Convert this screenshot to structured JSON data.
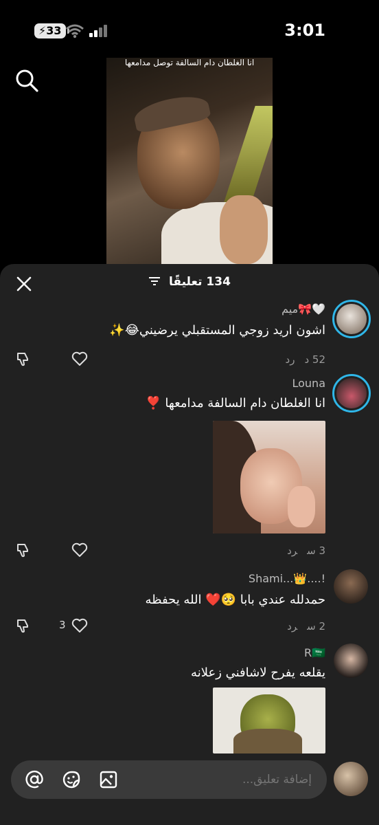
{
  "status_bar": {
    "battery": "33",
    "time": "3:01"
  },
  "video": {
    "overlay_text": "انا الغلطان دام السالفة توصل مدامعها"
  },
  "sheet": {
    "title": "134 تعليقًا"
  },
  "comments": [
    {
      "username": "ميم🎀🤍",
      "text": "اشون اريد زوجي المستقبلي يرضيني😂✨",
      "time": "52 د",
      "reply": "رد"
    },
    {
      "username": "Louna",
      "text": "انا الغلطان دام السالفة مدامعها ❣️",
      "time": "3 س",
      "reply": "رد"
    },
    {
      "username": "Shami...👑....!",
      "text": "حمدلله عندي بابا 🥺❤️ الله يحفظه",
      "time": "2 س",
      "reply": "رد",
      "likes": "3"
    },
    {
      "username": "R🇸🇦",
      "text": "يقلعه يفرح لاشافني زعلانه"
    }
  ],
  "input": {
    "placeholder": "إضافة تعليق..."
  },
  "icons": [
    "search-icon",
    "close-icon",
    "filter-icon",
    "dislike-icon",
    "heart-icon",
    "mention-icon",
    "sticker-icon",
    "image-icon"
  ]
}
